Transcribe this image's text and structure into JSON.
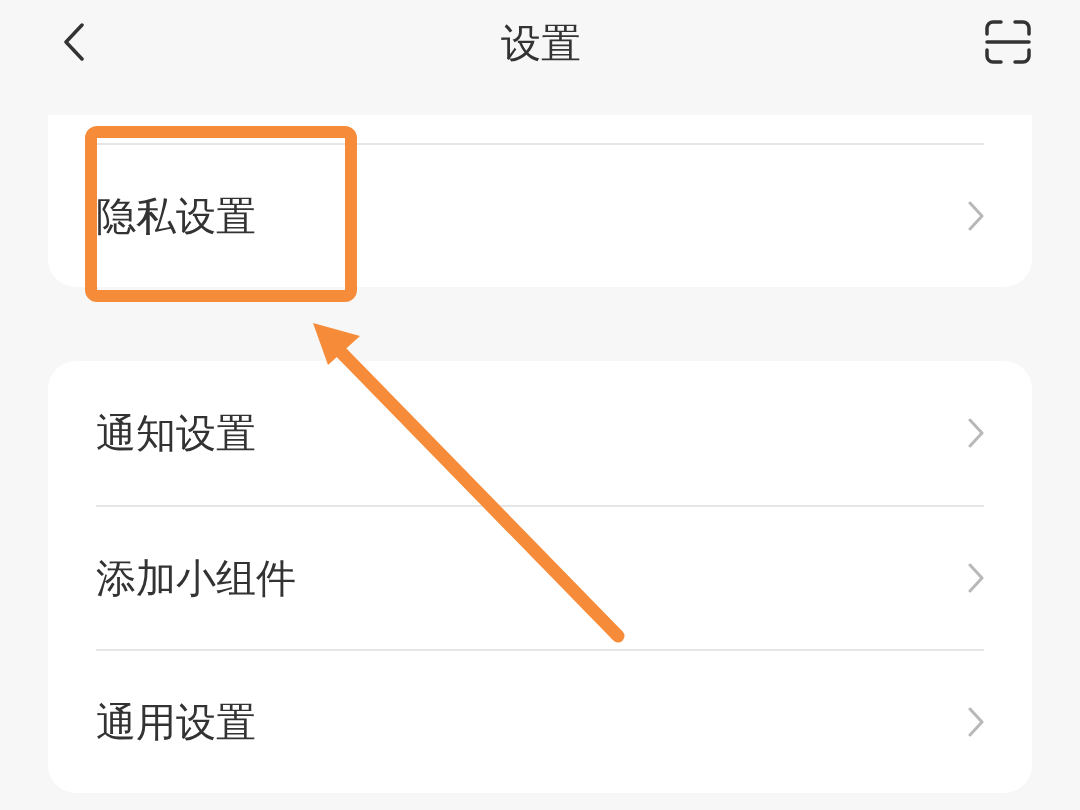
{
  "header": {
    "title": "设置"
  },
  "groups": [
    {
      "cut_top": true,
      "items": [
        {
          "label": "隐私设置"
        }
      ]
    },
    {
      "cut_top": false,
      "items": [
        {
          "label": "通知设置"
        },
        {
          "label": "添加小组件"
        },
        {
          "label": "通用设置"
        }
      ]
    }
  ],
  "annotation": {
    "kind": "highlight-arrow"
  }
}
